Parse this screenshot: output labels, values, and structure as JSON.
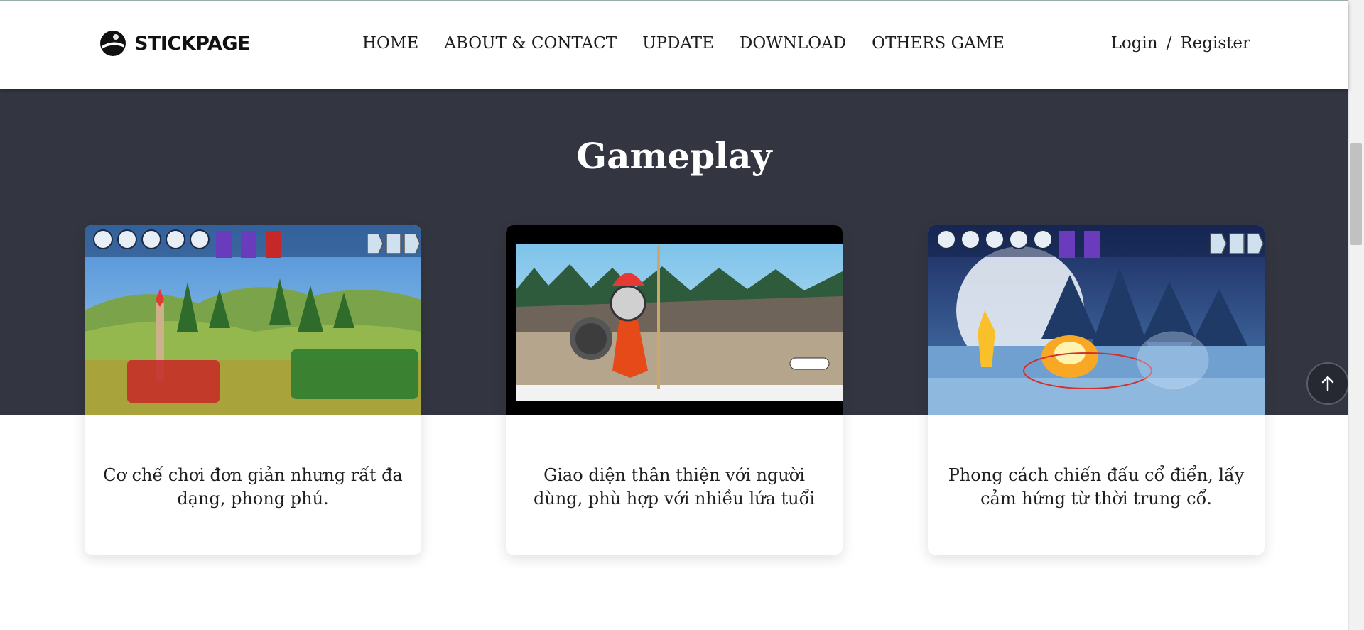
{
  "brand": {
    "name": "STICKPAGE"
  },
  "nav": {
    "items": [
      {
        "label": "HOME"
      },
      {
        "label": "ABOUT & CONTACT"
      },
      {
        "label": "UPDATE"
      },
      {
        "label": "DOWNLOAD"
      },
      {
        "label": "OTHERS GAME"
      }
    ]
  },
  "auth": {
    "login": "Login",
    "separator": "/",
    "register": "Register"
  },
  "section": {
    "title": "Gameplay"
  },
  "cards": [
    {
      "text": "Cơ chế chơi đơn giản nhưng rất đa dạng, phong phú.",
      "image": "army-battle-field-screenshot"
    },
    {
      "text": "Giao diện thân thiện với người dùng, phù hợp với nhiều lứa tuổi",
      "image": "spartan-stickman-menu-screenshot"
    },
    {
      "text": "Phong cách chiến đấu cổ điển, lấy cảm hứng từ thời trung cổ.",
      "image": "night-battle-explosion-screenshot"
    }
  ],
  "icons": {
    "back_to_top": "arrow-up-icon",
    "logo": "stickman-head-logo-icon"
  },
  "colors": {
    "band": "#333640",
    "header": "#ffffff",
    "text": "#1d1d1d",
    "accent_red": "#c62828"
  }
}
